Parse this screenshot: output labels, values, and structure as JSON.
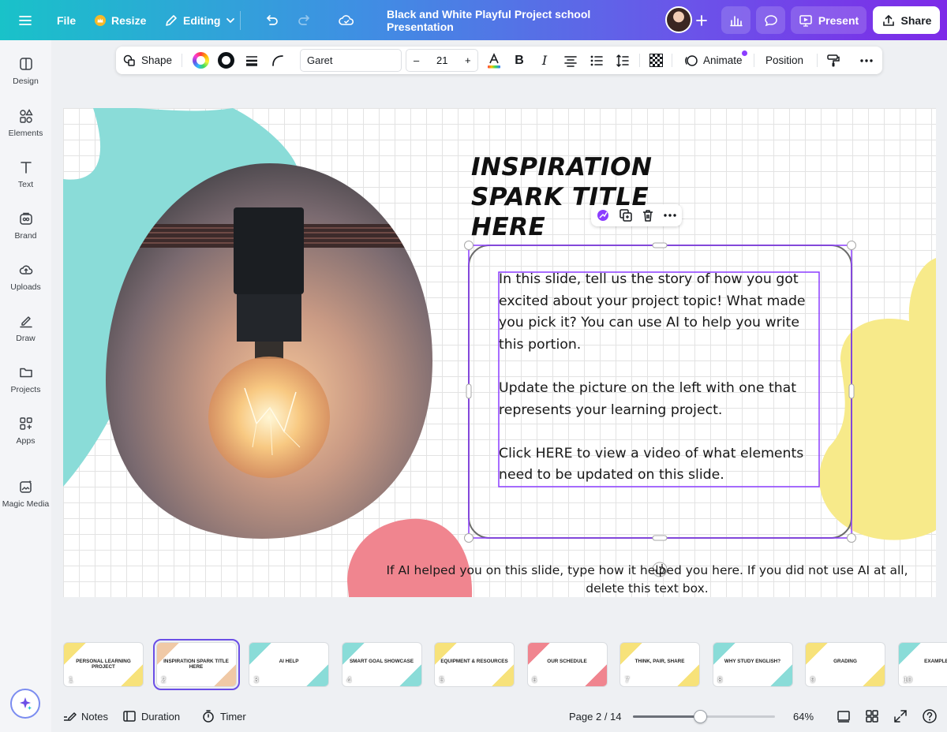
{
  "topbar": {
    "file": "File",
    "resize": "Resize",
    "editing": "Editing",
    "doc_title": "Black and White Playful Project school Presentation",
    "present": "Present",
    "share": "Share"
  },
  "rail": {
    "items": [
      {
        "label": "Design",
        "icon": "design-icon"
      },
      {
        "label": "Elements",
        "icon": "elements-icon"
      },
      {
        "label": "Text",
        "icon": "text-icon"
      },
      {
        "label": "Brand",
        "icon": "brand-icon"
      },
      {
        "label": "Uploads",
        "icon": "uploads-icon"
      },
      {
        "label": "Draw",
        "icon": "draw-icon"
      },
      {
        "label": "Projects",
        "icon": "projects-icon"
      },
      {
        "label": "Apps",
        "icon": "apps-icon"
      },
      {
        "label": "Magic Media",
        "icon": "magic-media-icon"
      }
    ]
  },
  "format": {
    "shape": "Shape",
    "font": "Garet",
    "size": "21",
    "minus": "–",
    "plus": "+",
    "bold": "B",
    "italic": "I",
    "animate": "Animate",
    "position": "Position"
  },
  "slide": {
    "title": "INSPIRATION SPARK TITLE HERE",
    "body_1": "In this slide, tell us the story of how you got excited about your project topic!  What made you pick it?  You can use AI to help you write this portion.",
    "body_2": "Update the picture on the left with one that represents your learning project.",
    "body_3": "Click HERE to view a video of what elements need to be updated on this slide.",
    "footer": "If AI helped you on this slide, type how it helped you here.  If you did not use AI at all, delete this text box."
  },
  "colors": {
    "teal_blob": "#8adcd8",
    "yellow_blob": "#f7ea8a",
    "pink_blob": "#f0858f",
    "selection": "#8b3dff"
  },
  "thumbnails": [
    {
      "num": "1",
      "title": "PERSONAL LEARNING PROJECT",
      "tint": "#f7e27a"
    },
    {
      "num": "2",
      "title": "INSPIRATION SPARK TITLE HERE",
      "tint": "#f0c9a6"
    },
    {
      "num": "3",
      "title": "AI HELP",
      "tint": "#8adcd8"
    },
    {
      "num": "4",
      "title": "SMART GOAL SHOWCASE",
      "tint": "#8adcd8"
    },
    {
      "num": "5",
      "title": "EQUIPMENT & RESOURCES",
      "tint": "#f7e27a"
    },
    {
      "num": "6",
      "title": "OUR SCHEDULE",
      "tint": "#f0858f"
    },
    {
      "num": "7",
      "title": "THINK, PAIR, SHARE",
      "tint": "#f7e27a"
    },
    {
      "num": "8",
      "title": "WHY STUDY ENGLISH?",
      "tint": "#8adcd8"
    },
    {
      "num": "9",
      "title": "GRADING",
      "tint": "#f7e27a"
    },
    {
      "num": "10",
      "title": "EXAMPLES",
      "tint": "#8adcd8"
    }
  ],
  "bottom": {
    "notes": "Notes",
    "duration": "Duration",
    "timer": "Timer",
    "page": "Page 2 / 14",
    "zoom": "64%",
    "zoom_fraction": 0.47
  }
}
